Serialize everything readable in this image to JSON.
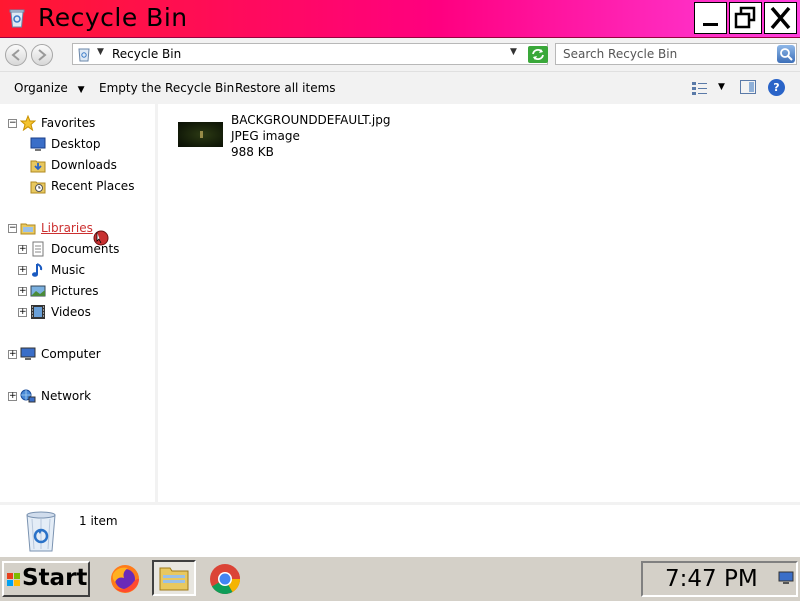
{
  "window": {
    "title": "Recycle Bin",
    "title_bar_color": "#ff0080"
  },
  "address_bar": {
    "path": "Recycle Bin",
    "search_placeholder": "Search Recycle Bin"
  },
  "toolbar": {
    "organize": "Organize",
    "empty": "Empty the Recycle Bin",
    "restore": "Restore all items"
  },
  "sidebar": {
    "favorites": {
      "label": "Favorites",
      "items": [
        {
          "label": "Desktop",
          "icon": "desktop-icon"
        },
        {
          "label": "Downloads",
          "icon": "downloads-icon"
        },
        {
          "label": "Recent Places",
          "icon": "recent-places-icon"
        }
      ]
    },
    "libraries": {
      "label": "Libraries",
      "items": [
        {
          "label": "Documents",
          "icon": "documents-icon"
        },
        {
          "label": "Music",
          "icon": "music-icon"
        },
        {
          "label": "Pictures",
          "icon": "pictures-icon"
        },
        {
          "label": "Videos",
          "icon": "videos-icon"
        }
      ]
    },
    "computer": {
      "label": "Computer"
    },
    "network": {
      "label": "Network"
    }
  },
  "files": [
    {
      "name": "BACKGROUNDDEFAULT.jpg",
      "type": "JPEG image",
      "size": "988 KB"
    }
  ],
  "details": {
    "count": "1 item"
  },
  "taskbar": {
    "start_label": "Start",
    "apps": [
      "firefox-icon",
      "explorer-icon",
      "chrome-icon"
    ],
    "clock": "7:47 PM"
  }
}
